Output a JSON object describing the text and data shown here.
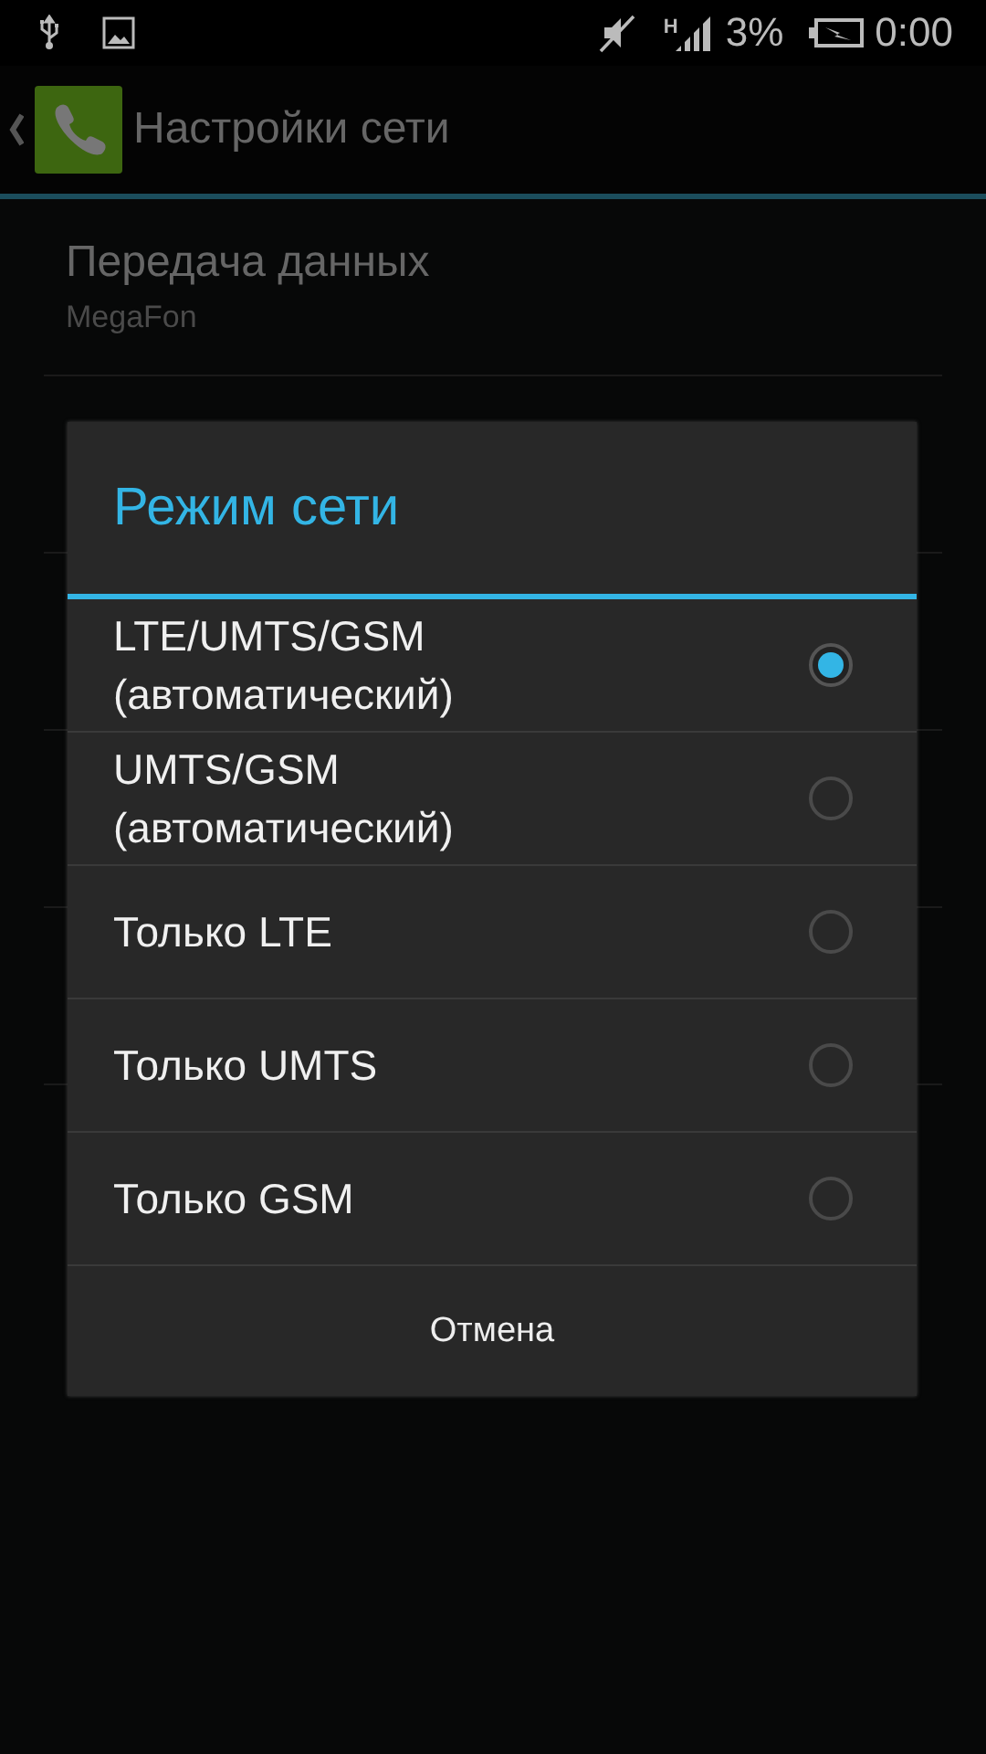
{
  "status_bar": {
    "network_type": "H",
    "battery_percent": "3%",
    "time": "0:00"
  },
  "action_bar": {
    "title": "Настройки сети"
  },
  "settings": [
    {
      "title": "Передача данных",
      "summary": "MegaFon"
    }
  ],
  "dialog": {
    "title": "Режим сети",
    "options": [
      {
        "label": "LTE/UMTS/GSM (автоматический)",
        "selected": true
      },
      {
        "label": "UMTS/GSM (автоматический)",
        "selected": false
      },
      {
        "label": "Только LTE",
        "selected": false
      },
      {
        "label": "Только UMTS",
        "selected": false
      },
      {
        "label": "Только GSM",
        "selected": false
      }
    ],
    "cancel": "Отмена"
  }
}
